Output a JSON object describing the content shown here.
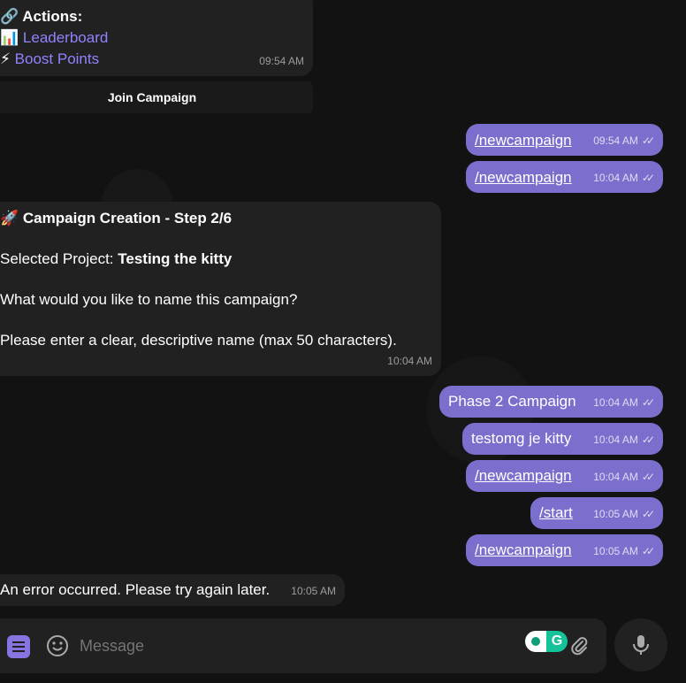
{
  "top_message": {
    "actions_label": "Actions:",
    "actions_icon": "🔗",
    "links": [
      {
        "icon": "📊",
        "label": "Leaderboard"
      },
      {
        "icon": "⚡",
        "label": "Boost Points"
      }
    ],
    "time": "09:54 AM",
    "button": "Join Campaign"
  },
  "outgoing_1": {
    "text": "/newcampaign",
    "time": "09:54 AM"
  },
  "outgoing_2": {
    "text": "/newcampaign",
    "time": "10:04 AM"
  },
  "step_message": {
    "icon": "🚀",
    "title": "Campaign Creation - Step 2/6",
    "project_label": "Selected Project: ",
    "project_name": "Testing the kitty",
    "question": "What would you like to name this campaign?",
    "hint": "Please enter a clear, descriptive name (max 50 characters).",
    "time": "10:04 AM"
  },
  "outgoing_3": {
    "text": "Phase 2 Campaign",
    "time": "10:04 AM"
  },
  "outgoing_4": {
    "text": "testomg je kitty",
    "time": "10:04 AM"
  },
  "outgoing_5": {
    "text": "/newcampaign",
    "time": "10:04 AM"
  },
  "outgoing_6": {
    "text": "/start",
    "time": "10:05 AM"
  },
  "outgoing_7": {
    "text": "/newcampaign",
    "time": "10:05 AM"
  },
  "error_message": {
    "text": "An error occurred. Please try again later.",
    "time": "10:05 AM"
  },
  "composer": {
    "placeholder": "Message"
  },
  "colors": {
    "outgoing": "#7b6fce",
    "incoming": "#212121",
    "accent": "#8f83ff"
  }
}
